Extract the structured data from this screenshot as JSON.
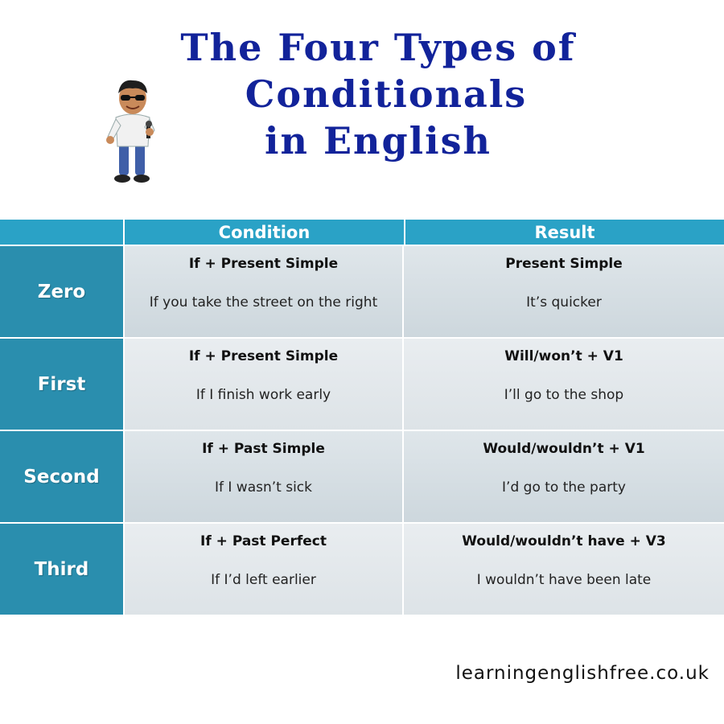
{
  "title": {
    "line1": "The Four Types of",
    "line2": "Conditionals",
    "line3": "in English"
  },
  "table": {
    "headers": {
      "condition": "Condition",
      "result": "Result"
    },
    "rows": [
      {
        "type": "Zero",
        "condition_formula": "If + Present Simple",
        "condition_example": "If you take the street on the right",
        "result_formula": "Present Simple",
        "result_example": "It’s quicker"
      },
      {
        "type": "First",
        "condition_formula": "If + Present Simple",
        "condition_example": "If I finish work early",
        "result_formula": "Will/won’t + V1",
        "result_example": "I’ll go to the shop"
      },
      {
        "type": "Second",
        "condition_formula": "If + Past Simple",
        "condition_example": "If I wasn’t sick",
        "result_formula": "Would/wouldn’t + V1",
        "result_example": "I’d go to the party"
      },
      {
        "type": "Third",
        "condition_formula": "If + Past Perfect",
        "condition_example": "If I’d left earlier",
        "result_formula": "Would/wouldn’t have + V3",
        "result_example": "I wouldn’t have been late"
      }
    ]
  },
  "footer": {
    "website": "learningenglishfree.co.uk"
  },
  "colors": {
    "title": "#12239a",
    "header": "#2aa2c6",
    "row_label": "#2a8eae"
  },
  "icons": {
    "mascot": "cartoon-man-with-sunglasses"
  }
}
